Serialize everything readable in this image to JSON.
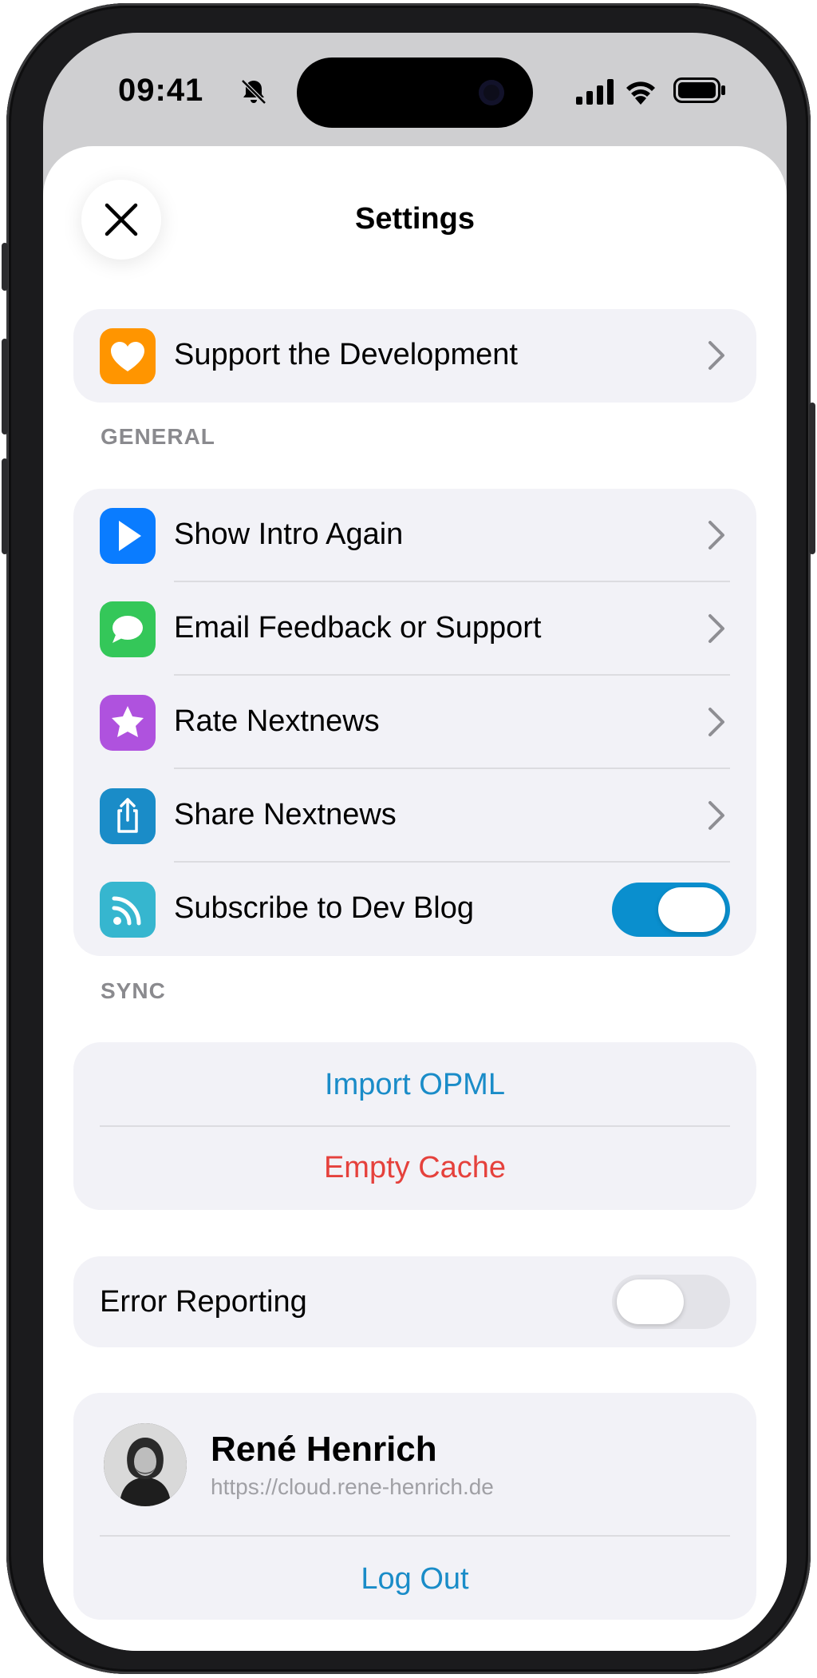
{
  "status_bar": {
    "time": "09:41",
    "icons": [
      "bell-slash-icon",
      "cellular-signal-icon",
      "wifi-icon",
      "battery-icon"
    ]
  },
  "header": {
    "title": "Settings",
    "close_icon": "close-icon"
  },
  "support": {
    "label": "Support the Development",
    "icon": "heart-icon",
    "icon_color": "#ff9500"
  },
  "general": {
    "header": "GENERAL",
    "items": [
      {
        "label": "Show Intro Again",
        "icon": "play-icon",
        "icon_color": "#0a7cff"
      },
      {
        "label": "Email Feedback or Support",
        "icon": "message-bubble-icon",
        "icon_color": "#34c759"
      },
      {
        "label": "Rate Nextnews",
        "icon": "star-icon",
        "icon_color": "#af52de"
      },
      {
        "label": "Share Nextnews",
        "icon": "share-icon",
        "icon_color": "#1a8cc8"
      },
      {
        "label": "Subscribe to Dev Blog",
        "icon": "rss-icon",
        "icon_color": "#36b6cf",
        "toggle": true
      }
    ]
  },
  "sync": {
    "header": "SYNC",
    "import_label": "Import OPML",
    "empty_cache_label": "Empty Cache",
    "import_color": "#1a8cc8",
    "empty_color": "#e5413c"
  },
  "error_reporting": {
    "label": "Error Reporting",
    "toggle": false
  },
  "account": {
    "name": "René Henrich",
    "url": "https://cloud.rene-henrich.de",
    "logout_label": "Log Out"
  },
  "colors": {
    "accent": "#1a8cc8",
    "toggle_on": "#0a8fce",
    "toggle_off": "#e3e3e8",
    "group_bg": "#f2f2f7"
  }
}
